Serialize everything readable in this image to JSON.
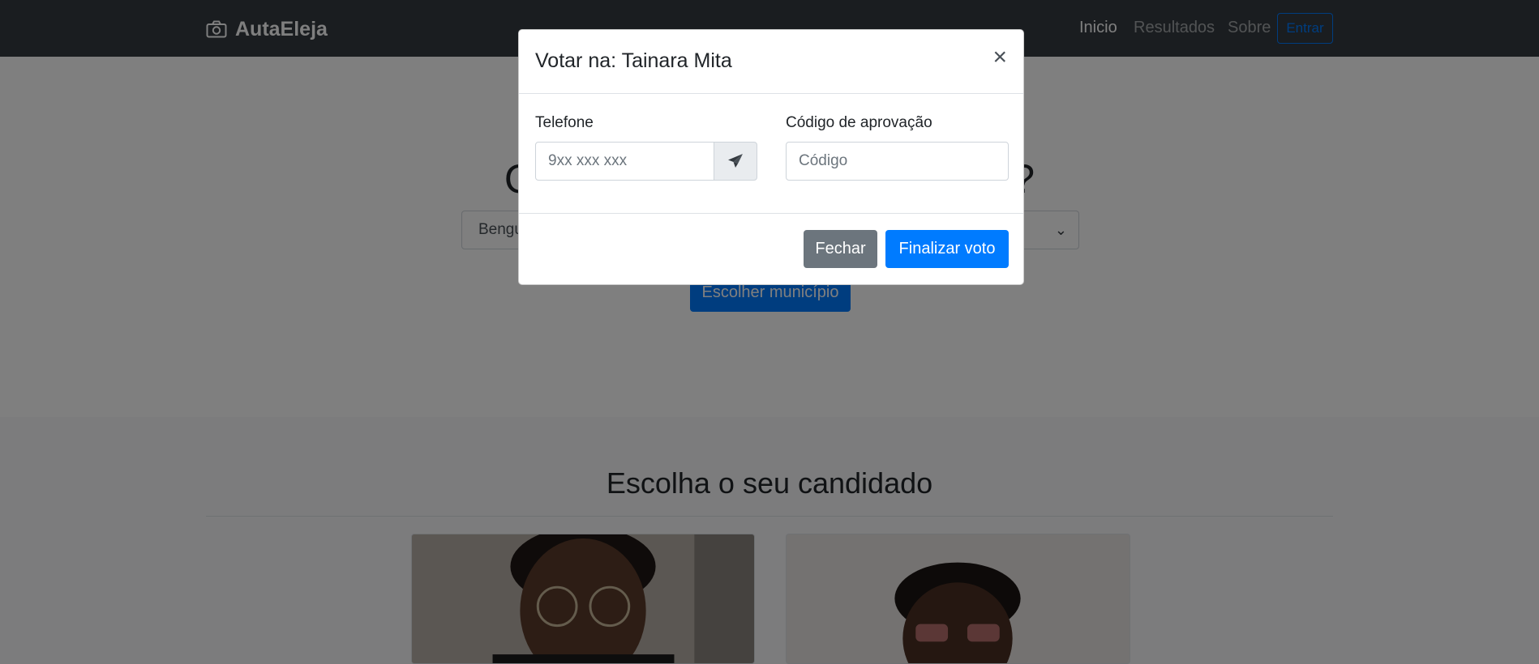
{
  "navbar": {
    "brand": "AutaEleja",
    "brand_icon": "camera-icon",
    "links": [
      "Inicio",
      "Resultados",
      "Sobre"
    ],
    "login_label": "Entrar"
  },
  "hero": {
    "title_prefix": "O",
    "title_suffix": "?",
    "select_value": "Bengu",
    "button_label": "Escolher município"
  },
  "candidates": {
    "title": "Escolha o seu candidado"
  },
  "modal": {
    "title": "Votar na: Tainara Mita",
    "close_symbol": "×",
    "phone_label": "Telefone",
    "phone_placeholder": "9xx xxx xxx",
    "send_icon": "paper-plane-icon",
    "code_label": "Código de aprovação",
    "code_placeholder": "Código",
    "close_button": "Fechar",
    "submit_button": "Finalizar voto"
  },
  "colors": {
    "primary": "#007bff",
    "secondary": "#6c757d",
    "navbar": "#343a40"
  }
}
